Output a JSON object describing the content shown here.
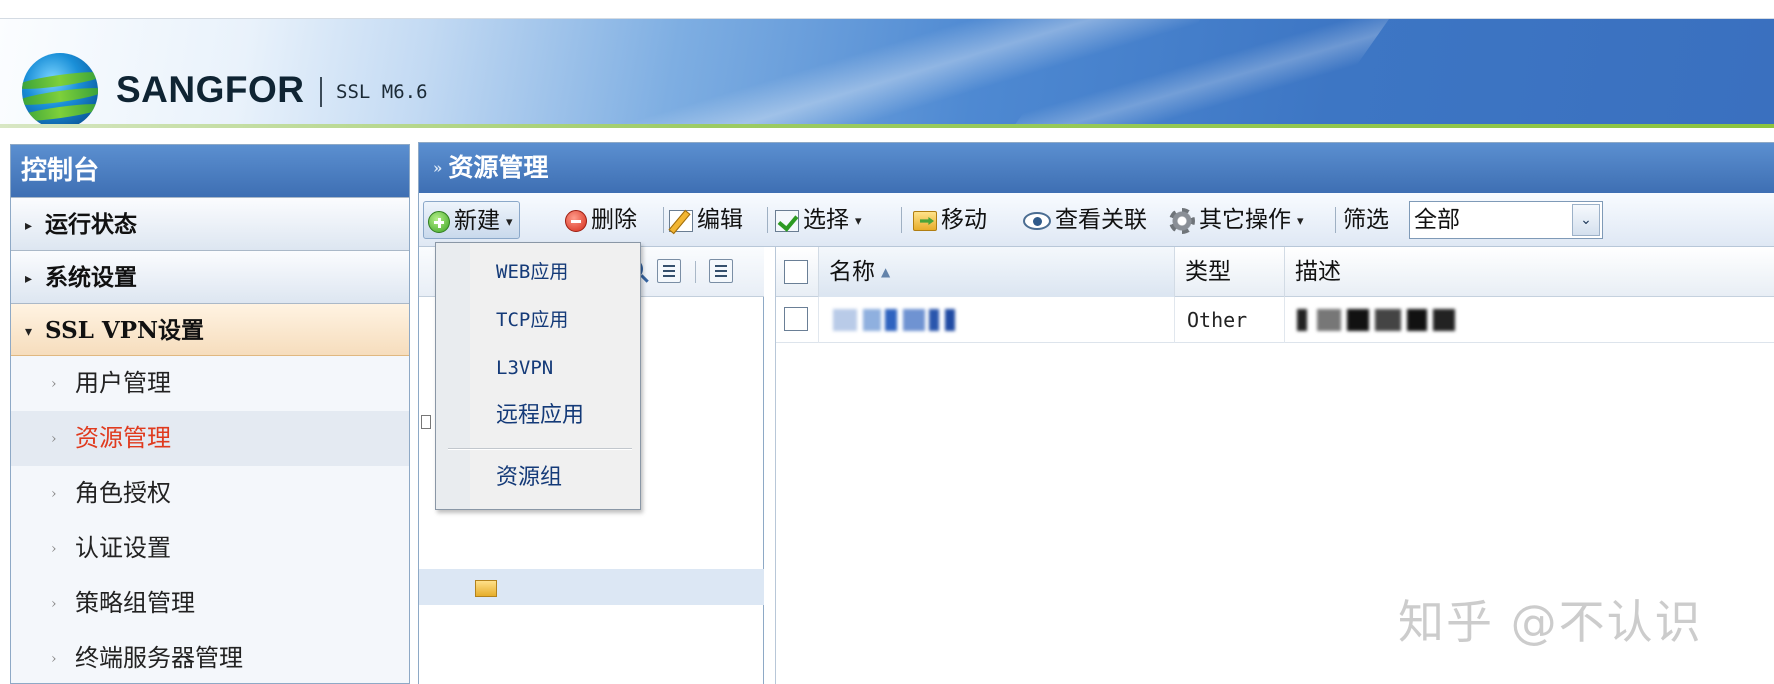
{
  "header": {
    "brand": "SANGFOR",
    "version": "SSL M6.6"
  },
  "sidebar": {
    "title": "控制台",
    "groups": [
      {
        "label": "运行状态",
        "arrow": "▸"
      },
      {
        "label": "系统设置",
        "arrow": "▸"
      },
      {
        "label": "SSL VPN设置",
        "arrow": "▾"
      }
    ],
    "items": [
      {
        "label": "用户管理"
      },
      {
        "label": "资源管理"
      },
      {
        "label": "角色授权"
      },
      {
        "label": "认证设置"
      },
      {
        "label": "策略组管理"
      },
      {
        "label": "终端服务器管理"
      }
    ],
    "item_arrow": "›"
  },
  "main": {
    "title": "资源管理",
    "title_chevron": "»",
    "toolbar": {
      "new_label": "新建",
      "delete_label": "删除",
      "edit_label": "编辑",
      "select_label": "选择",
      "move_label": "移动",
      "view_relation_label": "查看关联",
      "other_ops_label": "其它操作",
      "filter_label": "筛选",
      "filter_value": "全部",
      "dropdown_glyph": "▾",
      "select_glyph": "⌄"
    },
    "tree": {
      "partial_text": "寻"
    },
    "grid": {
      "columns": [
        "名称",
        "类型",
        "描述"
      ],
      "sort_glyph": "▲",
      "rows": [
        {
          "type": "Other"
        }
      ]
    }
  },
  "new_menu": {
    "items": [
      "WEB应用",
      "TCP应用",
      "L3VPN",
      "远程应用",
      "资源组"
    ]
  },
  "watermark": "知乎 @不认识",
  "colors": {
    "panel_title": "#3e6fb3",
    "active_item": "#e03a1e",
    "menu_text": "#143a78",
    "accent_green": "#8cc43e"
  }
}
